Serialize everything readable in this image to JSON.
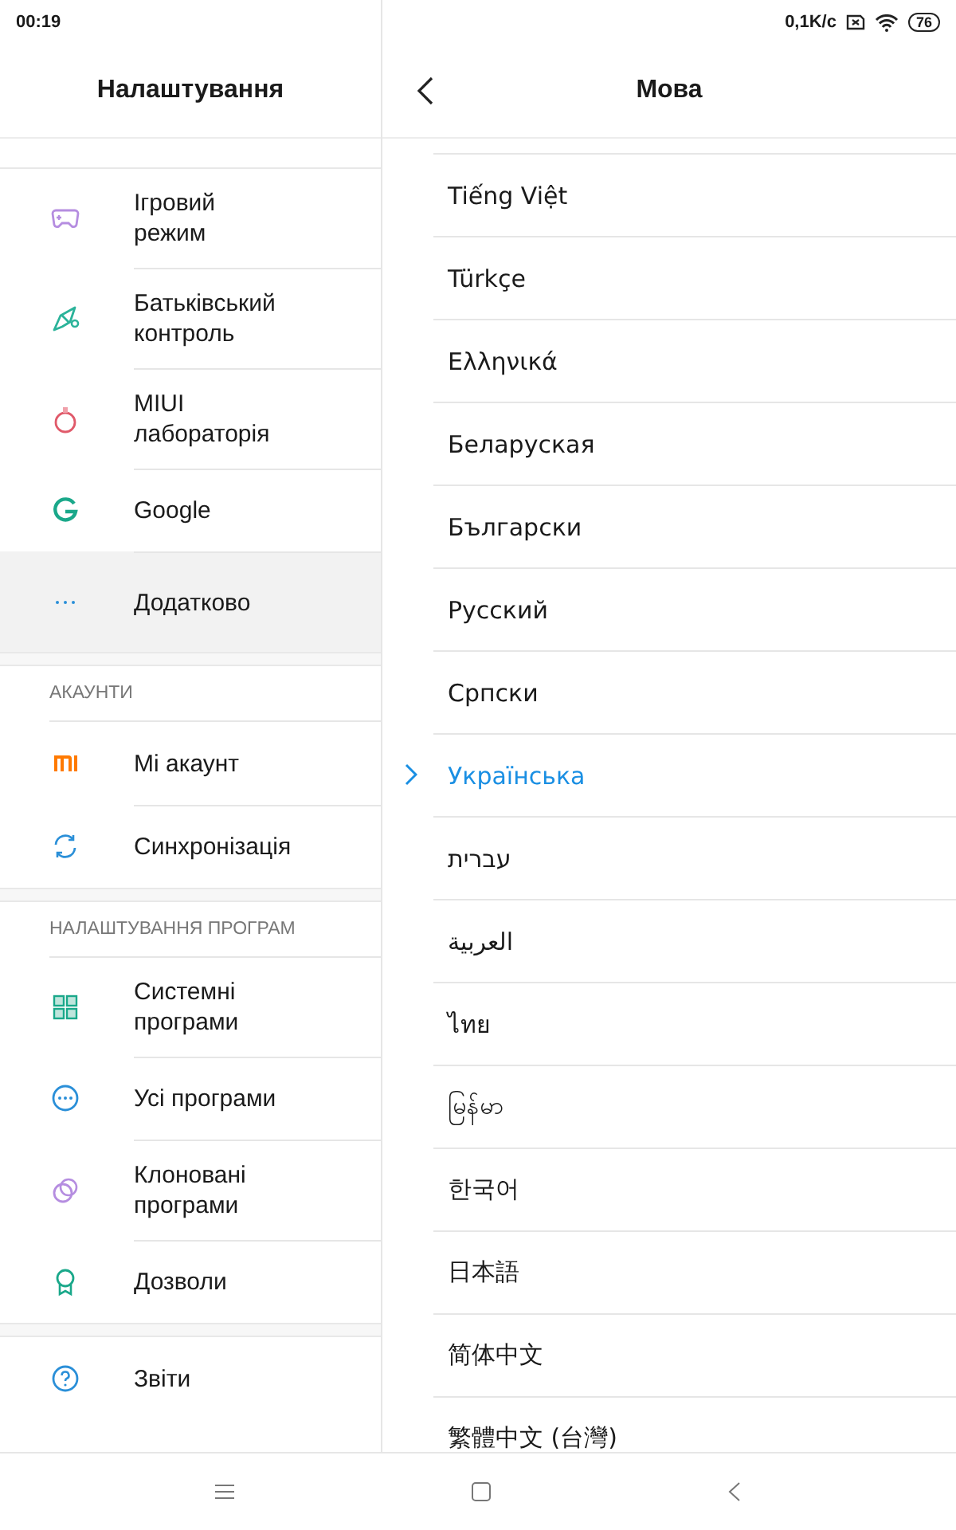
{
  "status_bar": {
    "time": "00:19",
    "network_speed": "0,1K/с",
    "battery": "76"
  },
  "settings_panel": {
    "title": "Налаштування",
    "groups": [
      {
        "items": [
          {
            "label": "Ігровий\nрежим",
            "selected": false
          },
          {
            "label": "Батьківський\nконтроль",
            "selected": false
          },
          {
            "label": "MIUI\nлабораторія",
            "selected": false
          },
          {
            "label": "Google",
            "selected": false
          },
          {
            "label": "Додатково",
            "selected": true
          }
        ]
      },
      {
        "header": "АКАУНТИ",
        "items": [
          {
            "label": "Mi акаунт",
            "selected": false
          },
          {
            "label": "Синхронізація",
            "selected": false
          }
        ]
      },
      {
        "header": "НАЛАШТУВАННЯ ПРОГРАМ",
        "items": [
          {
            "label": "Системні\nпрограми",
            "selected": false
          },
          {
            "label": "Усі програми",
            "selected": false
          },
          {
            "label": "Клоновані\nпрограми",
            "selected": false
          },
          {
            "label": "Дозволи",
            "selected": false
          }
        ]
      },
      {
        "items": [
          {
            "label": "Звіти",
            "selected": false
          }
        ]
      }
    ]
  },
  "language_panel": {
    "title": "Мова",
    "languages": [
      {
        "label": "Tiếng Việt",
        "selected": false
      },
      {
        "label": "Türkçe",
        "selected": false
      },
      {
        "label": "Ελληνικά",
        "selected": false
      },
      {
        "label": "Беларуская",
        "selected": false
      },
      {
        "label": "Български",
        "selected": false
      },
      {
        "label": "Русский",
        "selected": false
      },
      {
        "label": "Српски",
        "selected": false
      },
      {
        "label": "Українська",
        "selected": true
      },
      {
        "label": "עברית",
        "selected": false
      },
      {
        "label": "العربية",
        "selected": false
      },
      {
        "label": "ไทย",
        "selected": false
      },
      {
        "label": "မြန်မာ",
        "selected": false
      },
      {
        "label": "한국어",
        "selected": false
      },
      {
        "label": "日本語",
        "selected": false
      },
      {
        "label": "简体中文",
        "selected": false
      },
      {
        "label": "繁體中文 (台灣)",
        "selected": false
      }
    ]
  }
}
